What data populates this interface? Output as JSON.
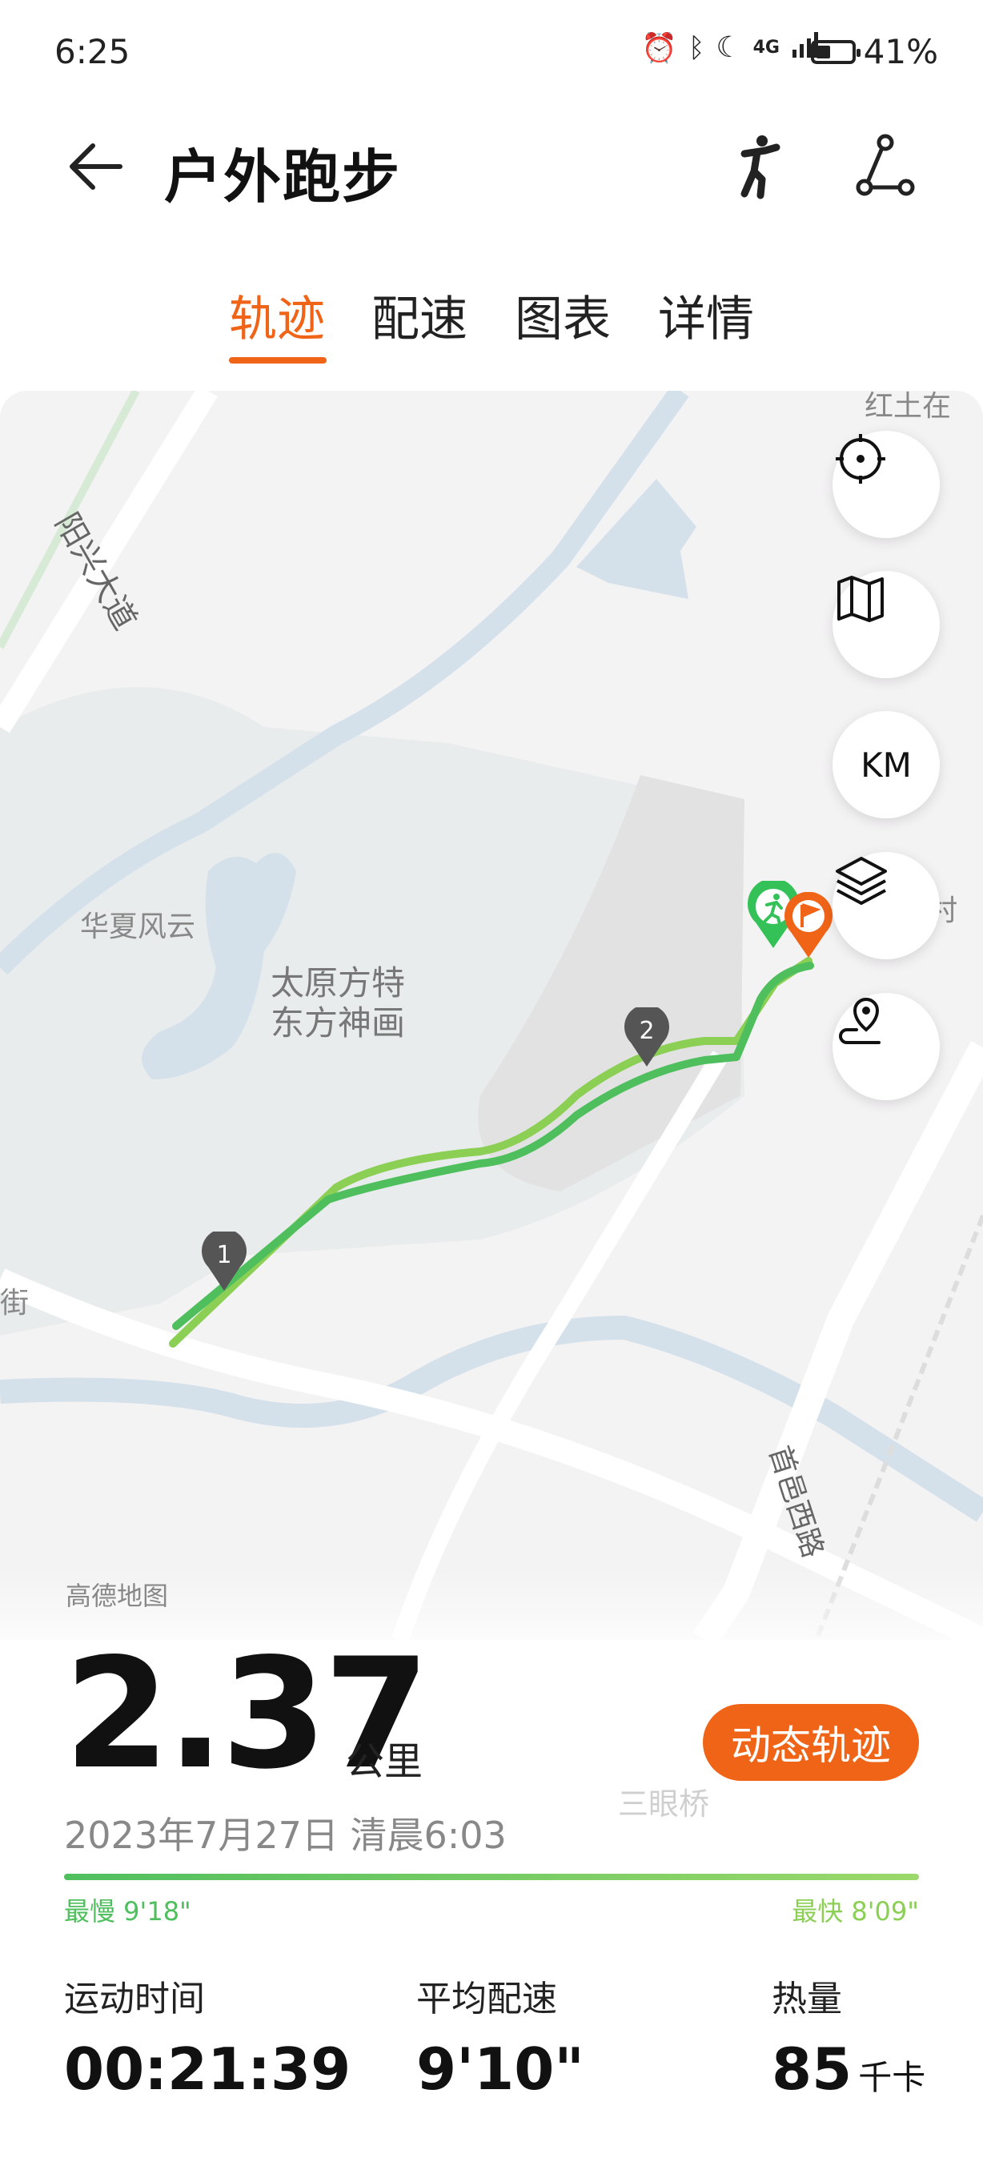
{
  "status_bar": {
    "time": "6:25",
    "network": "4G",
    "battery_percent": "41%",
    "battery_level": 0.41
  },
  "header": {
    "title": "户外跑步",
    "back_icon": "arrow-left-icon",
    "posture_icon": "running-posture-icon",
    "share_icon": "share-route-icon"
  },
  "tabs": [
    {
      "label": "轨迹",
      "active": true
    },
    {
      "label": "配速",
      "active": false
    },
    {
      "label": "图表",
      "active": false
    },
    {
      "label": "详情",
      "active": false
    }
  ],
  "map": {
    "places": {
      "road_yangxing": "阳兴大道",
      "huaxia": "华夏风云",
      "park_line1": "太原方特",
      "park_line2": "东方神画",
      "jie": "街",
      "road_shouyi": "首邑西路",
      "cun": "村",
      "bridge": "三眼桥",
      "top_right": "红土在"
    },
    "markers": [
      "1",
      "2"
    ],
    "controls": {
      "locate": "crosshair-icon",
      "map_type": "map-icon",
      "unit": "KM",
      "layers": "layers-icon",
      "route": "route-pin-icon"
    },
    "attribution": "高德地图"
  },
  "summary": {
    "distance": "2.37",
    "distance_unit": "公里",
    "dynamic_track_button": "动态轨迹",
    "date": "2023年7月27日 清晨6:03",
    "slowest": "最慢 9'18\"",
    "fastest": "最快 8'09\""
  },
  "stats": {
    "duration_label": "运动时间",
    "duration": "00:21:39",
    "pace_label": "平均配速",
    "pace": "9'10\"",
    "calories_label": "热量",
    "calories": "85",
    "calories_unit": "千卡"
  },
  "colors": {
    "accent": "#f06418",
    "route_start": "#8bcf55",
    "route_end": "#4fbf5e",
    "water": "#d4e0ea",
    "park": "#e9ecec"
  }
}
